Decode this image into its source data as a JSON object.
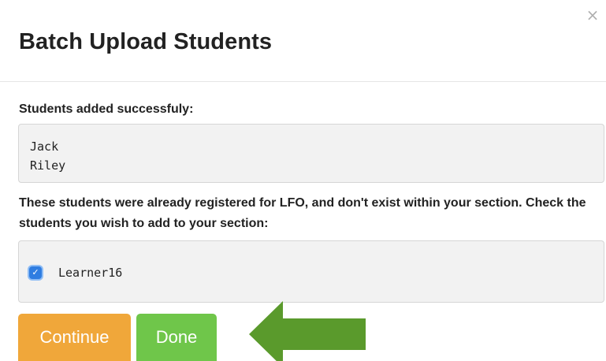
{
  "modal": {
    "title": "Batch Upload Students",
    "close_label": "×"
  },
  "added": {
    "label": "Students added successfuly:",
    "students": [
      "Jack",
      "Riley"
    ]
  },
  "registered": {
    "label": "These students were already registered for LFO, and don't exist within your section. Check the students you wish to add to your section:",
    "learners": [
      {
        "name": "Learner16",
        "checked": true,
        "check_glyph": "✓"
      }
    ]
  },
  "buttons": {
    "continue_label": "Continue",
    "done_label": "Done"
  },
  "colors": {
    "continue_button": "#f0a73a",
    "done_button": "#6fc64a",
    "arrow": "#5a9a2c",
    "checkbox": "#2f7de1"
  },
  "icons": {
    "close": "close-icon",
    "checkbox": "checkbox-checked-icon",
    "arrow": "arrow-left-icon"
  }
}
